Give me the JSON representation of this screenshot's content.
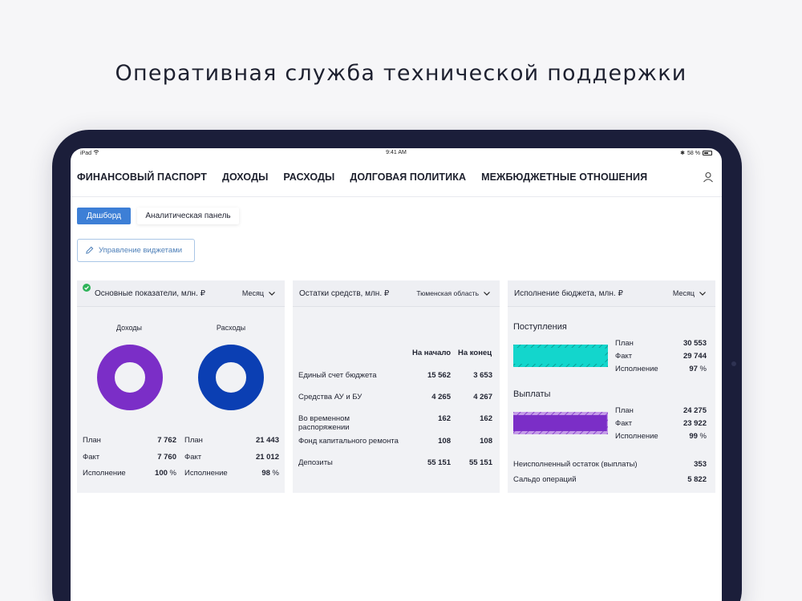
{
  "headline": "Оперативная служба технической поддержки",
  "statusbar": {
    "device": "iPad",
    "time": "9:41 AM",
    "battery": "58 %"
  },
  "nav": {
    "items": [
      "ФИНАНСОВЫЙ ПАСПОРТ",
      "ДОХОДЫ",
      "РАСХОДЫ",
      "ДОЛГОВАЯ ПОЛИТИКА",
      "МЕЖБЮДЖЕТНЫЕ ОТНОШЕНИЯ"
    ]
  },
  "tabs": {
    "active": "Дашборд",
    "other": "Аналитическая панель"
  },
  "widgets_button": "Управление виджетами",
  "card_main": {
    "title": "Основные показатели, млн. ₽",
    "period": "Месяц",
    "income": {
      "label": "Доходы",
      "plan_label": "План",
      "plan": "7 762",
      "fact_label": "Факт",
      "fact": "7 760",
      "exec_label": "Исполнение",
      "exec": "100",
      "exec_unit": "%",
      "color": "#7b2ec7"
    },
    "expense": {
      "label": "Расходы",
      "plan_label": "План",
      "plan": "21 443",
      "fact_label": "Факт",
      "fact": "21 012",
      "exec_label": "Исполнение",
      "exec": "98",
      "exec_unit": "%",
      "color": "#0b3fb3"
    }
  },
  "card_balance": {
    "title": "Остатки средств, млн. ₽",
    "region": "Тюменская область",
    "col_start": "На начало",
    "col_end": "На конец",
    "rows": [
      {
        "name": "Единый счет бюджета",
        "start": "15 562",
        "end": "3 653"
      },
      {
        "name": "Средства АУ и БУ",
        "start": "4 265",
        "end": "4 267"
      },
      {
        "name": "Во временном распоряжении",
        "start": "162",
        "end": "162"
      },
      {
        "name": "Фонд капитального ремонта",
        "start": "108",
        "end": "108"
      },
      {
        "name": "Депозиты",
        "start": "55 151",
        "end": "55 151"
      }
    ]
  },
  "card_exec": {
    "title": "Исполнение бюджета, млн. ₽",
    "period": "Месяц",
    "receipts": {
      "title": "Поступления",
      "plan_label": "План",
      "plan": "30 553",
      "fact_label": "Факт",
      "fact": "29 744",
      "exec_label": "Исполнение",
      "exec": "97",
      "exec_unit": "%",
      "color": "#13d6cc"
    },
    "payments": {
      "title": "Выплаты",
      "plan_label": "План",
      "plan": "24 275",
      "fact_label": "Факт",
      "fact": "23 922",
      "exec_label": "Исполнение",
      "exec": "99",
      "exec_unit": "%",
      "color": "#7b2ec7"
    },
    "unexecuted_label": "Неисполненный остаток (выплаты)",
    "unexecuted": "353",
    "saldo_label": "Сальдо операций",
    "saldo": "5 822"
  }
}
